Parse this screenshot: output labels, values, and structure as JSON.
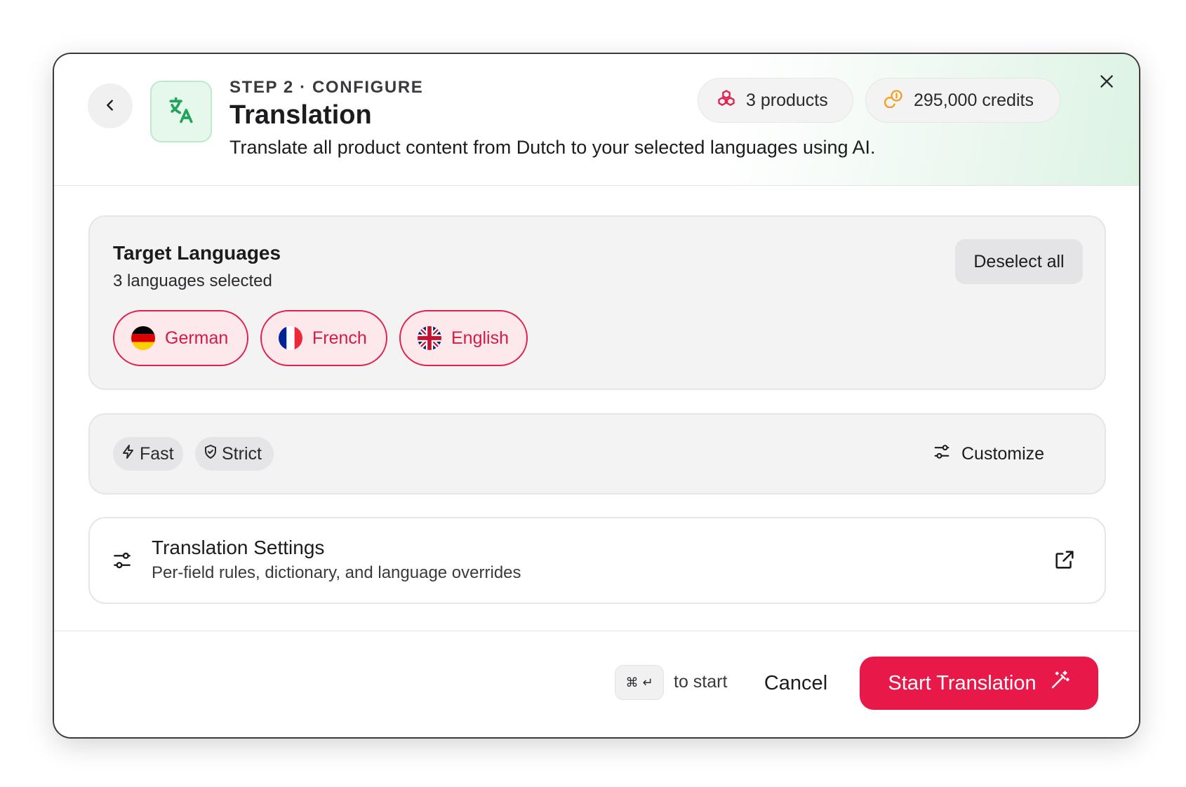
{
  "header": {
    "step_label": "STEP 2 · CONFIGURE",
    "title": "Translation",
    "subtitle": "Translate all product content from Dutch to your selected languages using AI.",
    "products_label": "3 products",
    "credits_label": "295,000 credits",
    "back_icon": "chevron-left-icon",
    "app_icon": "translate-icon",
    "close_icon": "close-icon"
  },
  "languages": {
    "title": "Target Languages",
    "count_label": "3 languages selected",
    "deselect_label": "Deselect all",
    "items": [
      {
        "label": "German",
        "flag": "flag-de-icon",
        "selected": true
      },
      {
        "label": "French",
        "flag": "flag-fr-icon",
        "selected": true
      },
      {
        "label": "English",
        "flag": "flag-gb-icon",
        "selected": true
      }
    ]
  },
  "options": {
    "modes": [
      {
        "label": "Fast",
        "icon": "lightning-icon"
      },
      {
        "label": "Strict",
        "icon": "shield-check-icon"
      }
    ],
    "customize_label": "Customize"
  },
  "settings_link": {
    "title": "Translation Settings",
    "description": "Per-field rules, dictionary, and language overrides"
  },
  "footer": {
    "shortcut_label": "to start",
    "cancel_label": "Cancel",
    "start_label": "Start Translation"
  },
  "colors": {
    "accent": "#e81949",
    "selected_pill_bg": "#fde8ec",
    "app_icon_green": "#22a55a",
    "credits_orange": "#f0a020"
  }
}
